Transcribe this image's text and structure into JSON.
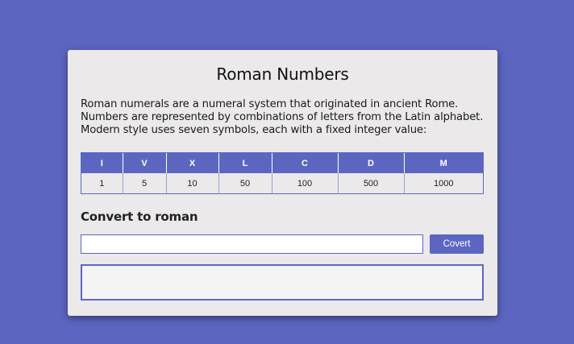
{
  "page": {
    "title": "Roman Numbers",
    "intro": "Roman numerals are a numeral system that originated in ancient Rome. Numbers are represented by combinations of letters from the Latin alphabet. Modern style uses seven symbols, each with a fixed integer value:"
  },
  "table": {
    "symbols": [
      "I",
      "V",
      "X",
      "L",
      "C",
      "D",
      "M"
    ],
    "values": [
      "1",
      "5",
      "10",
      "50",
      "100",
      "500",
      "1000"
    ]
  },
  "converter": {
    "heading": "Convert to roman",
    "input_value": "",
    "button_label": "Covert",
    "result": ""
  },
  "colors": {
    "background": "#5c66c1",
    "accent": "#5c66c1",
    "card": "#ebe9ea"
  }
}
